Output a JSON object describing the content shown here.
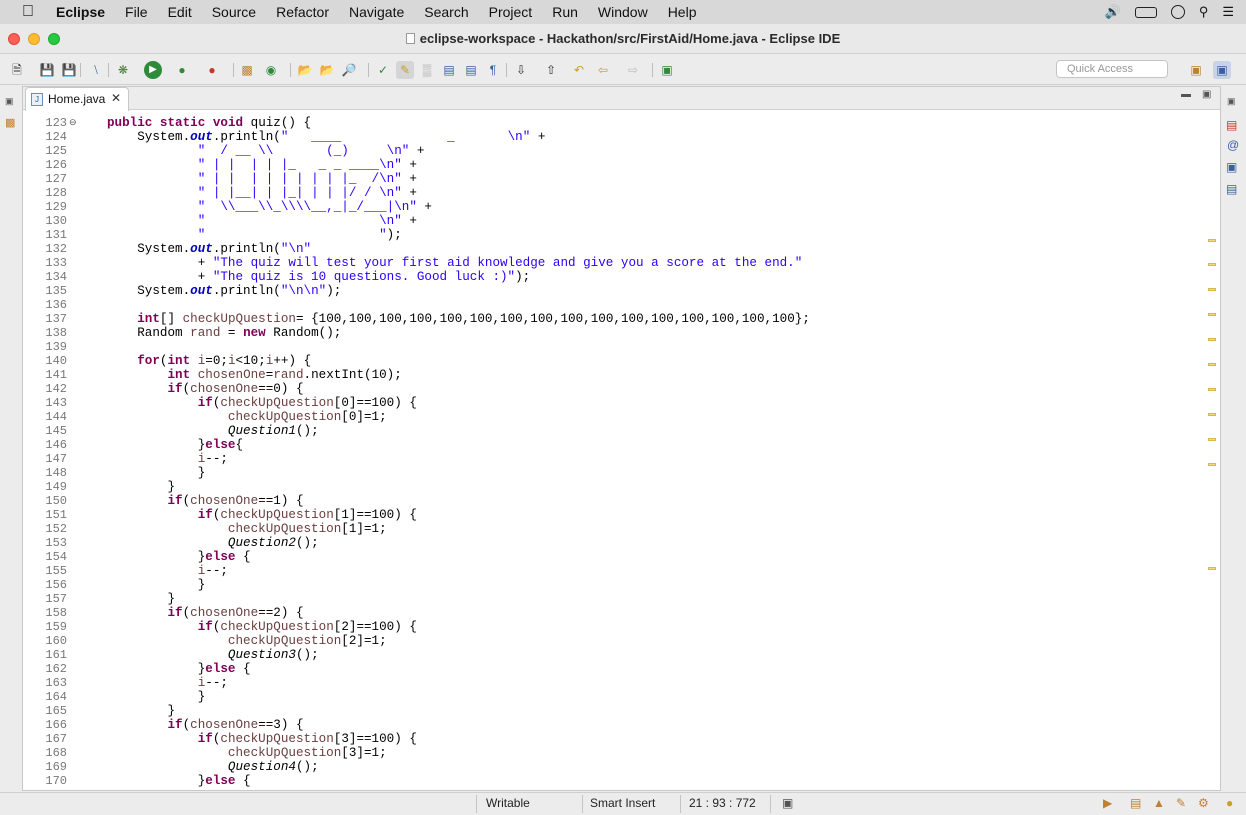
{
  "menubar": {
    "app": "Eclipse",
    "items": [
      "File",
      "Edit",
      "Source",
      "Refactor",
      "Navigate",
      "Search",
      "Project",
      "Run",
      "Window",
      "Help"
    ]
  },
  "window": {
    "title": "eclipse-workspace - Hackathon/src/FirstAid/Home.java - Eclipse IDE"
  },
  "toolbar": {
    "quick_access_placeholder": "Quick Access"
  },
  "editor": {
    "tab_label": "Home.java",
    "line_numbers": [
      "123",
      "124",
      "125",
      "126",
      "127",
      "128",
      "129",
      "130",
      "131",
      "132",
      "133",
      "134",
      "135",
      "136",
      "137",
      "138",
      "139",
      "140",
      "141",
      "142",
      "143",
      "144",
      "145",
      "146",
      "147",
      "148",
      "149",
      "150",
      "151",
      "152",
      "153",
      "154",
      "155",
      "156",
      "157",
      "158",
      "159",
      "160",
      "161",
      "162",
      "163",
      "164",
      "165",
      "166",
      "167",
      "168",
      "169",
      "170"
    ],
    "lines": [
      "public static void quiz() {",
      "    System.out.println(\"   ____              _       \\n\" +",
      "            \"  / __ \\\\       (_)     \\n\" +",
      "            \" | |  | | |_   _ _ ____\\n\" +",
      "            \" | |  | | | | | | |_  /\\n\" +",
      "            \" | |__| | |_| | | |/ / \\n\" +",
      "            \"  \\\\___\\\\_\\\\\\\\__,_|_/___|\\n\" +",
      "            \"                       \\n\" +",
      "            \"                       \");",
      "    System.out.println(\"\\n\"",
      "            + \"The quiz will test your first aid knowledge and give you a score at the end.\"",
      "            + \"The quiz is 10 questions. Good luck :)\");",
      "    System.out.println(\"\\n\\n\");",
      "",
      "    int[] checkUpQuestion= {100,100,100,100,100,100,100,100,100,100,100,100,100,100,100,100};",
      "    Random rand = new Random();",
      "",
      "    for(int i=0;i<10;i++) {",
      "        int chosenOne=rand.nextInt(10);",
      "        if(chosenOne==0) {",
      "            if(checkUpQuestion[0]==100) {",
      "                checkUpQuestion[0]=1;",
      "                Question1();",
      "            }else{",
      "            i--;",
      "            }",
      "        }",
      "        if(chosenOne==1) {",
      "            if(checkUpQuestion[1]==100) {",
      "                checkUpQuestion[1]=1;",
      "                Question2();",
      "            }else {",
      "            i--;",
      "            }",
      "        }",
      "        if(chosenOne==2) {",
      "            if(checkUpQuestion[2]==100) {",
      "                checkUpQuestion[2]=1;",
      "                Question3();",
      "            }else {",
      "            i--;",
      "            }",
      "        }",
      "        if(chosenOne==3) {",
      "            if(checkUpQuestion[3]==100) {",
      "                checkUpQuestion[3]=1;",
      "                Question4();",
      "            }else {"
    ]
  },
  "statusbar": {
    "writable": "Writable",
    "insert_mode": "Smart Insert",
    "position": "21 : 93 : 772"
  },
  "colors": {
    "keyword": "#7f0055",
    "string": "#2a00ff",
    "static_field": "#0000c0",
    "local_var": "#6a3e3e"
  }
}
